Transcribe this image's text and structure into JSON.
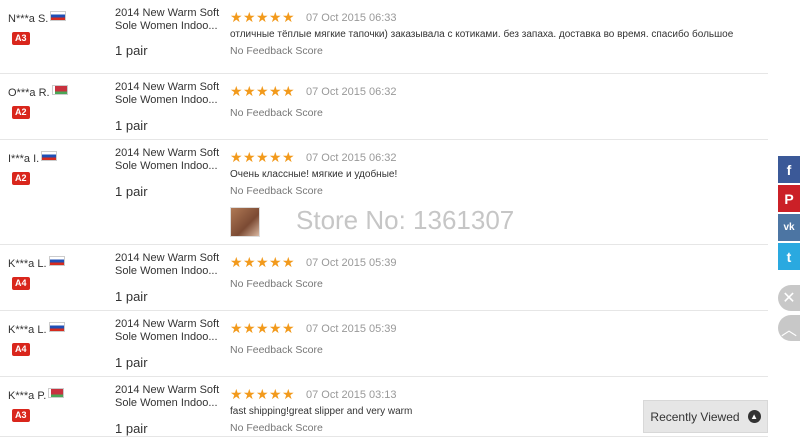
{
  "feedback": [
    {
      "buyer": "N***a S.",
      "flag": "ru",
      "level": "A3",
      "product": "2014 New Warm Soft Sole Women Indoo...",
      "qty": "1 pair",
      "date": "07 Oct 2015 06:33",
      "comment": "отличные тёплые мягкие тапочки) заказывала с котиками. без запаха. доставка во время. спасибо большое",
      "score": "No Feedback Score",
      "photo": false
    },
    {
      "buyer": "O***a R.",
      "flag": "by",
      "level": "A2",
      "product": "2014 New Warm Soft Sole Women Indoo...",
      "qty": "1 pair",
      "date": "07 Oct 2015 06:32",
      "comment": "",
      "score": "No Feedback Score",
      "photo": false
    },
    {
      "buyer": "I***a I.",
      "flag": "ru",
      "level": "A2",
      "product": "2014 New Warm Soft Sole Women Indoo...",
      "qty": "1 pair",
      "date": "07 Oct 2015 06:32",
      "comment": "Очень классные! мягкие и удобные!",
      "score": "No Feedback Score",
      "photo": true
    },
    {
      "buyer": "K***a L.",
      "flag": "ru",
      "level": "A4",
      "product": "2014 New Warm Soft Sole Women Indoo...",
      "qty": "1 pair",
      "date": "07 Oct 2015 05:39",
      "comment": "",
      "score": "No Feedback Score",
      "photo": false
    },
    {
      "buyer": "K***a L.",
      "flag": "ru",
      "level": "A4",
      "product": "2014 New Warm Soft Sole Women Indoo...",
      "qty": "1 pair",
      "date": "07 Oct 2015 05:39",
      "comment": "",
      "score": "No Feedback Score",
      "photo": false
    },
    {
      "buyer": "K***a P.",
      "flag": "by",
      "level": "A3",
      "product": "2014 New Warm Soft Sole Women Indoo...",
      "qty": "1 pair",
      "date": "07 Oct 2015 03:13",
      "comment": "fast shipping!great slipper and very warm",
      "score": "No Feedback Score",
      "photo": false
    }
  ],
  "rating_stars": 5,
  "watermark": "Store No: 1361307",
  "share": {
    "facebook": "f",
    "pinterest": "P",
    "vk": "vk",
    "twitter": "t"
  },
  "recently_viewed": "Recently Viewed",
  "colors": {
    "star": "#f29a1c",
    "level_badge": "#d9261c"
  }
}
